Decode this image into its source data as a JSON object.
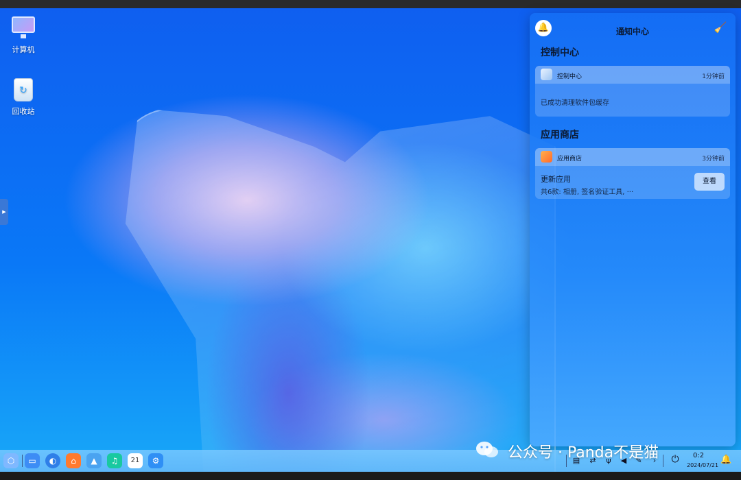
{
  "desktop": {
    "icons": [
      {
        "label": "计算机",
        "icon": "computer-icon"
      },
      {
        "label": "回收站",
        "icon": "trash-icon"
      }
    ],
    "side_handle_icon": "chevron-right-icon"
  },
  "notification_center": {
    "title": "通知中心",
    "bell_icon": "bell-icon",
    "clear_icon": "broom-icon",
    "groups": [
      {
        "section_title": "控制中心",
        "app_name": "控制中心",
        "time": "1分钟前",
        "message": "已成功清理软件包缓存"
      },
      {
        "section_title": "应用商店",
        "app_name": "应用商店",
        "time": "3分钟前",
        "message_title": "更新应用",
        "message": "共6款: 相册, 签名验证工具, ···",
        "action_label": "查看"
      }
    ]
  },
  "taskbar": {
    "apps": [
      {
        "name": "multitask-view",
        "icon": "cube-icon",
        "color": "#5aa7ff"
      },
      {
        "name": "file-manager",
        "icon": "folder-icon",
        "color": "#3d8df5"
      },
      {
        "name": "browser",
        "icon": "browser-icon",
        "color": "#2f7fe8"
      },
      {
        "name": "app-store",
        "icon": "bag-icon",
        "color": "#ff7a2e"
      },
      {
        "name": "image-viewer",
        "icon": "image-icon",
        "color": "#4aa3f0"
      },
      {
        "name": "music",
        "icon": "music-icon",
        "color": "#19c9a0"
      },
      {
        "name": "calendar",
        "icon": "calendar-icon",
        "color": "#ffffff",
        "text": "21"
      },
      {
        "name": "settings",
        "icon": "gear-icon",
        "color": "#2f8ff5"
      }
    ],
    "tray": [
      "keyboard-icon",
      "network-icon",
      "usb-icon",
      "volume-icon",
      "pen-icon",
      "chevron-icon",
      "power-icon"
    ],
    "clock_time": "0:2",
    "clock_date": "2024/07/21"
  },
  "watermark": {
    "text": "公众号 · Panda不是猫"
  }
}
